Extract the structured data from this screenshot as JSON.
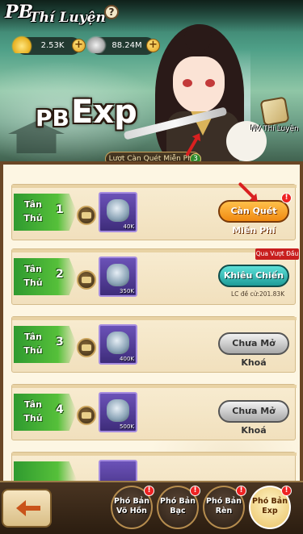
{
  "header": {
    "title_line1": "PB",
    "title_line2": "Thí Luyện",
    "help_icon": "?",
    "gold_value": "2.53K",
    "silver_value": "88.24M",
    "plus_icon": "+",
    "banner_pb": "PB",
    "banner_exp": "Exp",
    "quest_label": "NV Thí Luyện",
    "free_sweep_label": "Lượt Càn Quét Miễn Phí:",
    "free_sweep_count": "3"
  },
  "rows": [
    {
      "tier": "Tân Thủ",
      "level": "1",
      "reward_qty": "40K",
      "action": "Càn Quét Miễn Phí",
      "action_style": "orange",
      "alert": "!"
    },
    {
      "tier": "Tân Thủ",
      "level": "2",
      "reward_qty": "350K",
      "action": "Khiêu Chiến",
      "action_style": "teal",
      "note": "LC đề cử:201.83K",
      "ribbon": "Qua Vượt Đầu"
    },
    {
      "tier": "Tân Thủ",
      "level": "3",
      "reward_qty": "400K",
      "action": "Chưa Mở Khoá",
      "action_style": "gray"
    },
    {
      "tier": "Tân Thủ",
      "level": "4",
      "reward_qty": "500K",
      "action": "Chưa Mở Khoá",
      "action_style": "gray"
    }
  ],
  "bottom_nav": {
    "tabs": [
      {
        "label": "Phó Bản Võ Hồn",
        "alert": "!"
      },
      {
        "label": "Phó Bản Bạc",
        "alert": "!"
      },
      {
        "label": "Phó Bản Rèn",
        "alert": "!"
      },
      {
        "label": "Phó Bản Exp",
        "alert": "!",
        "active": true
      }
    ]
  },
  "colors": {
    "accent_orange": "#f08a12",
    "accent_teal": "#1e9c98",
    "tier_green": "#56c03a",
    "alert_red": "#e22222"
  }
}
